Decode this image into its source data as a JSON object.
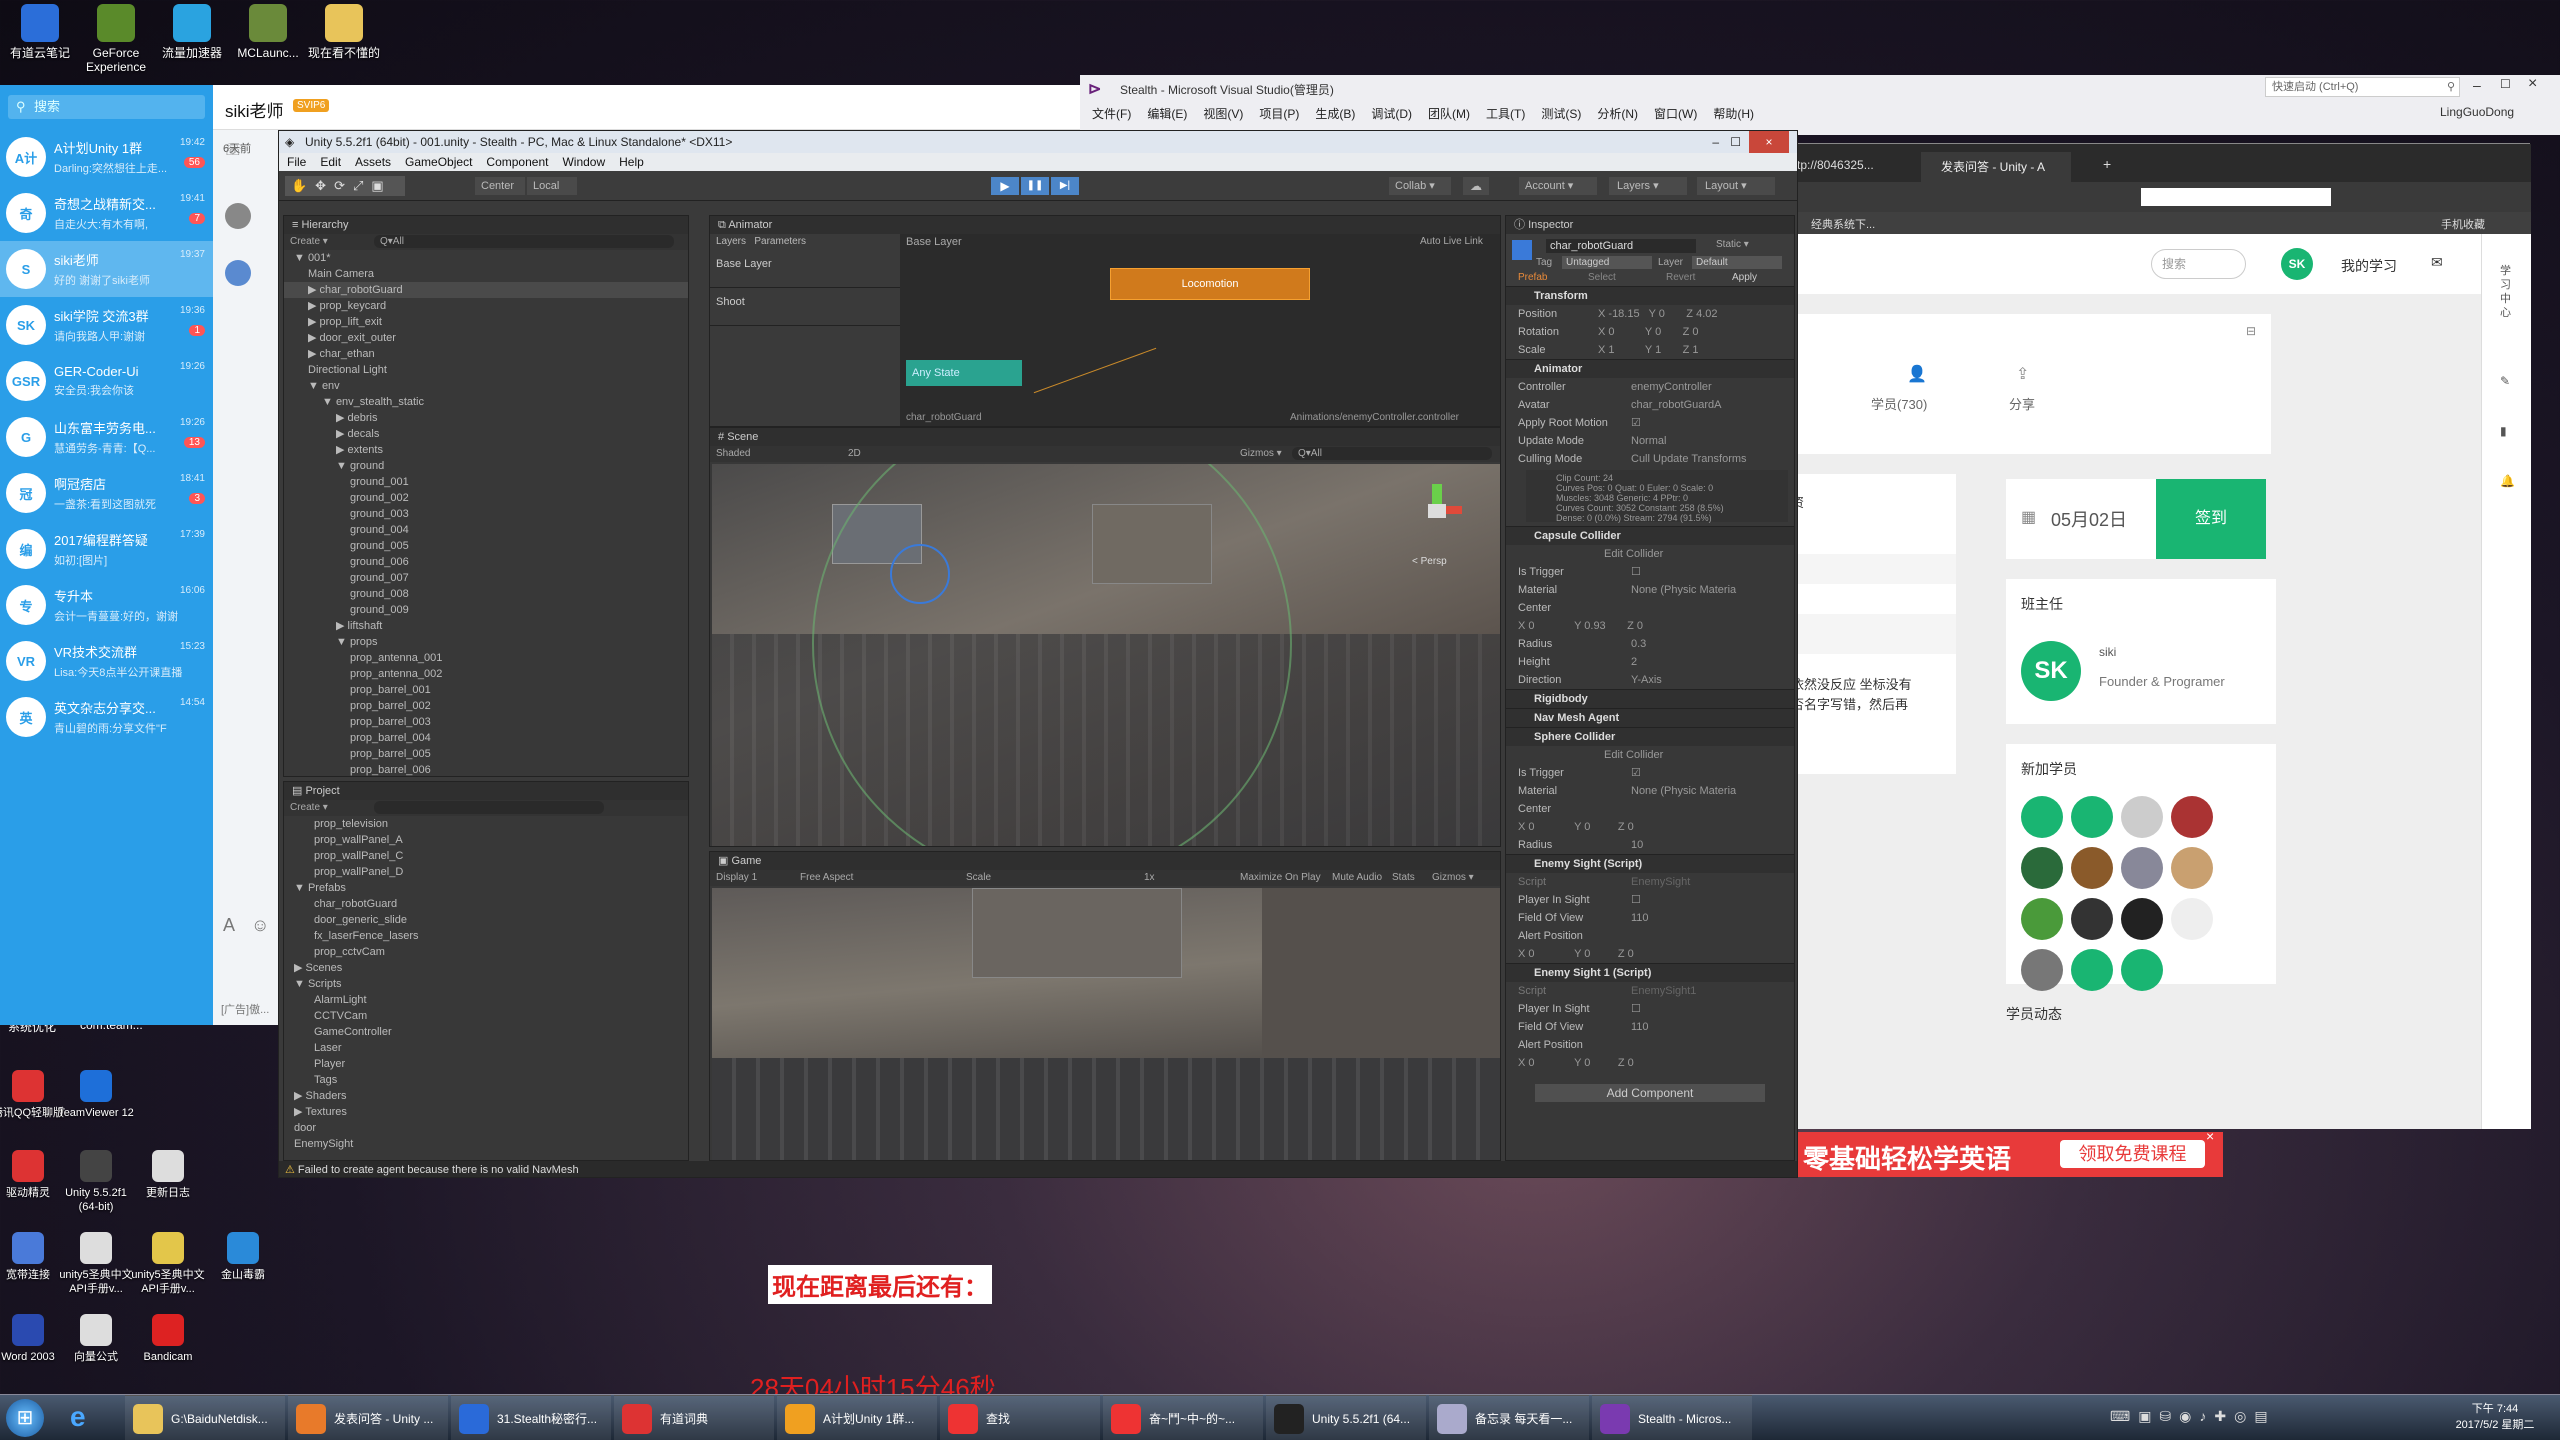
{
  "desktop": {
    "icons": [
      {
        "label": "有道云笔记",
        "color": "#2b6ed9"
      },
      {
        "label": "GeForce Experience",
        "color": "#5a8a2a"
      },
      {
        "label": "流量加速器",
        "color": "#2aa3e0"
      },
      {
        "label": "MCLaunc...",
        "color": "#6a8a3a"
      },
      {
        "label": "现在看不懂的",
        "color": "#e8c45a"
      }
    ],
    "left_icons": [
      {
        "label": "腾讯QQ轻聊版",
        "color": "#d33"
      },
      {
        "label": "TeamViewer 12",
        "color": "#1e6fd9"
      },
      {
        "label": "驱动精灵",
        "color": "#d33"
      },
      {
        "label": "Unity 5.5.2f1 (64-bit)",
        "color": "#444"
      },
      {
        "label": "更新日志",
        "color": "#ddd"
      },
      {
        "label": "宽带连接",
        "color": "#4a7ad9"
      },
      {
        "label": "unity5圣典中文API手册v...",
        "color": "#ddd"
      },
      {
        "label": "unity5圣典中文API手册v...",
        "color": "#e3c64a"
      },
      {
        "label": "金山毒霸",
        "color": "#2a8ad9"
      },
      {
        "label": "Word 2003",
        "color": "#2a4ab0"
      },
      {
        "label": "向量公式",
        "color": "#ddd"
      },
      {
        "label": "Bandicam",
        "color": "#d22"
      }
    ],
    "strip": [
      "系统优化",
      "com.team..."
    ],
    "countdown_label": "现在距离最后还有：",
    "countdown_value": "28天04小时15分46秒",
    "ad_text": "零基础轻松学英语",
    "ad_button": "领取免费课程"
  },
  "qq": {
    "user": "siki老师",
    "vip": "SVIP6",
    "search": "搜索",
    "side_text": "6天前",
    "ad": "[广告]傲...",
    "chats": [
      {
        "name": "A计划Unity 1群",
        "preview": "Darling:突然想往上走...",
        "time": "19:42",
        "badge": "56",
        "av": "A计"
      },
      {
        "name": "奇想之战精新交...",
        "preview": "自走火大:有木有啊,",
        "time": "19:41",
        "badge": "7",
        "av": "奇"
      },
      {
        "name": "siki老师",
        "preview": "好的 谢谢了siki老师",
        "time": "19:37",
        "badge": "",
        "av": "S"
      },
      {
        "name": "siki学院 交流3群",
        "preview": "请向我路人甲:谢谢",
        "time": "19:36",
        "badge": "1",
        "av": "SK"
      },
      {
        "name": "GER-Coder-Ui",
        "preview": "安全员:我会你该",
        "time": "19:26",
        "badge": "",
        "av": "GSR"
      },
      {
        "name": "山东富丰劳务电...",
        "preview": "慧通劳务-青青:【Q...",
        "time": "19:26",
        "badge": "13",
        "av": "G"
      },
      {
        "name": "啊冠痞店",
        "preview": "一盏茶:看到这图就死",
        "time": "18:41",
        "badge": "3",
        "av": "冠"
      },
      {
        "name": "2017编程群答疑",
        "preview": "如初:[图片]",
        "time": "17:39",
        "badge": "",
        "av": "编"
      },
      {
        "name": "专升本",
        "preview": "会计一青蔓蔓:好的，谢谢",
        "time": "16:06",
        "badge": "",
        "av": "专"
      },
      {
        "name": "VR技术交流群",
        "preview": "Lisa:今天8点半公开课直播",
        "time": "15:23",
        "badge": "",
        "av": "VR"
      },
      {
        "name": "英文杂志分享交...",
        "preview": "青山碧的雨:分享文件\"F",
        "time": "14:54",
        "badge": "",
        "av": "英"
      }
    ]
  },
  "vs": {
    "title": "Stealth - Microsoft Visual Studio(管理员)",
    "quick": "快速启动 (Ctrl+Q)",
    "user": "LingGuoDong",
    "menu": [
      "文件(F)",
      "编辑(E)",
      "视图(V)",
      "项目(P)",
      "生成(B)",
      "调试(D)",
      "团队(M)",
      "工具(T)",
      "测试(S)",
      "分析(N)",
      "窗口(W)",
      "帮助(H)"
    ]
  },
  "browser": {
    "tab1": "tp://8046325...",
    "tab2": "发表问答 - Unity - A",
    "bookmark": "经典系统下...",
    "phone": "手机收藏",
    "search": "搜索",
    "my_study": "我的学习",
    "students": "学员(730)",
    "share": "分享",
    "date": "05月02日",
    "checkin": "签到",
    "owner_title": "班主任",
    "owner_name": "siki",
    "owner_role": "Founder & Programer",
    "new_students": "新加学员",
    "dynamics": "学员动态",
    "side_chars": "学习中心",
    "snippet1": "资",
    "snippet2": "依然没反应 坐标没有",
    "snippet3": "否名字写错，然后再"
  },
  "unity": {
    "title": "Unity 5.5.2f1 (64bit) - 001.unity - Stealth - PC, Mac & Linux Standalone* <DX11>",
    "menu": [
      "File",
      "Edit",
      "Assets",
      "GameObject",
      "Component",
      "Window",
      "Help"
    ],
    "toolbar": {
      "center": "Center",
      "local": "Local",
      "collab": "Collab ▾",
      "account": "Account ▾",
      "layers": "Layers ▾",
      "layout": "Layout ▾"
    },
    "hierarchy": {
      "title": "Hierarchy",
      "create": "Create ▾",
      "search": "Q▾All",
      "items": [
        {
          "t": "▼ 001*",
          "d": 0
        },
        {
          "t": "Main Camera",
          "d": 1
        },
        {
          "t": "▶ char_robotGuard",
          "d": 1
        },
        {
          "t": "▶ prop_keycard",
          "d": 1
        },
        {
          "t": "▶ prop_lift_exit",
          "d": 1
        },
        {
          "t": "▶ door_exit_outer",
          "d": 1
        },
        {
          "t": "▶ char_ethan",
          "d": 1
        },
        {
          "t": "Directional Light",
          "d": 1
        },
        {
          "t": "▼ env",
          "d": 1
        },
        {
          "t": "▼ env_stealth_static",
          "d": 2
        },
        {
          "t": "▶ debris",
          "d": 3
        },
        {
          "t": "▶ decals",
          "d": 3
        },
        {
          "t": "▶ extents",
          "d": 3
        },
        {
          "t": "▼ ground",
          "d": 3
        },
        {
          "t": "ground_001",
          "d": 4
        },
        {
          "t": "ground_002",
          "d": 4
        },
        {
          "t": "ground_003",
          "d": 4
        },
        {
          "t": "ground_004",
          "d": 4
        },
        {
          "t": "ground_005",
          "d": 4
        },
        {
          "t": "ground_006",
          "d": 4
        },
        {
          "t": "ground_007",
          "d": 4
        },
        {
          "t": "ground_008",
          "d": 4
        },
        {
          "t": "ground_009",
          "d": 4
        },
        {
          "t": "▶ liftshaft",
          "d": 3
        },
        {
          "t": "▼ props",
          "d": 3
        },
        {
          "t": "prop_antenna_001",
          "d": 4
        },
        {
          "t": "prop_antenna_002",
          "d": 4
        },
        {
          "t": "prop_barrel_001",
          "d": 4
        },
        {
          "t": "prop_barrel_002",
          "d": 4
        },
        {
          "t": "prop_barrel_003",
          "d": 4
        },
        {
          "t": "prop_barrel_004",
          "d": 4
        },
        {
          "t": "prop_barrel_005",
          "d": 4
        },
        {
          "t": "prop_barrel_006",
          "d": 4
        }
      ]
    },
    "project": {
      "title": "Project",
      "create": "Create ▾",
      "items": [
        {
          "t": "prop_television",
          "d": 1
        },
        {
          "t": "prop_wallPanel_A",
          "d": 1
        },
        {
          "t": "prop_wallPanel_C",
          "d": 1
        },
        {
          "t": "prop_wallPanel_D",
          "d": 1
        },
        {
          "t": "▼ Prefabs",
          "d": 0
        },
        {
          "t": "char_robotGuard",
          "d": 1
        },
        {
          "t": "door_generic_slide",
          "d": 1
        },
        {
          "t": "fx_laserFence_lasers",
          "d": 1
        },
        {
          "t": "prop_cctvCam",
          "d": 1
        },
        {
          "t": "▶ Scenes",
          "d": 0
        },
        {
          "t": "▼ Scripts",
          "d": 0
        },
        {
          "t": "AlarmLight",
          "d": 1
        },
        {
          "t": "CCTVCam",
          "d": 1
        },
        {
          "t": "GameController",
          "d": 1
        },
        {
          "t": "Laser",
          "d": 1
        },
        {
          "t": "Player",
          "d": 1
        },
        {
          "t": "Tags",
          "d": 1
        },
        {
          "t": "▶ Shaders",
          "d": 0
        },
        {
          "t": "▶ Textures",
          "d": 0
        },
        {
          "t": "door",
          "d": 0
        },
        {
          "t": "EnemySight",
          "d": 0
        }
      ]
    },
    "animator": {
      "title": "Animator",
      "tabs": [
        "Layers",
        "Parameters"
      ],
      "base_layer": "Base Layer",
      "layers": [
        "Base Layer",
        "Shoot"
      ],
      "auto_live": "Auto Live Link",
      "state": "Locomotion",
      "any_state": "Any State",
      "footer_left": "char_robotGuard",
      "footer_right": "Animations/enemyController.controller"
    },
    "scene": {
      "title": "Scene",
      "shaded": "Shaded",
      "mode2d": "2D",
      "gizmos": "Gizmos ▾",
      "search": "Q▾All",
      "persp": "< Persp"
    },
    "game": {
      "title": "Game",
      "display": "Display 1",
      "aspect": "Free Aspect",
      "scale": "Scale",
      "scale_val": "1x",
      "maximize": "Maximize On Play",
      "mute": "Mute Audio",
      "stats": "Stats",
      "gizmos": "Gizmos ▾"
    },
    "inspector": {
      "title": "Inspector",
      "object": "char_robotGuard",
      "static": "Static ▾",
      "tag_label": "Tag",
      "tag": "Untagged",
      "layer_label": "Layer",
      "layer": "Default",
      "prefab": "Prefab",
      "select": "Select",
      "revert": "Revert",
      "apply": "Apply",
      "transform": "Transform",
      "position": "Position",
      "px": "-18.15",
      "py": "0",
      "pz": "4.02",
      "rotation": "Rotation",
      "rx": "0",
      "ry": "0",
      "rz": "0",
      "scale": "Scale",
      "sx": "1",
      "sy": "1",
      "sz": "1",
      "animator": "Animator",
      "controller_l": "Controller",
      "controller": "enemyController",
      "avatar_l": "Avatar",
      "avatar": "char_robotGuardA",
      "root_motion": "Apply Root Motion",
      "update_l": "Update Mode",
      "update": "Normal",
      "culling_l": "Culling Mode",
      "culling": "Cull Update Transforms",
      "anim_info": "Clip Count: 24\nCurves Pos: 0 Quat: 0 Euler: 0 Scale: 0\nMuscles: 3048 Generic: 4 PPtr: 0\nCurves Count: 3052 Constant: 258 (8.5%)\nDense: 0 (0.0%) Stream: 2794 (91.5%)",
      "capsule": "Capsule Collider",
      "edit_collider": "Edit Collider",
      "is_trigger": "Is Trigger",
      "material": "Material",
      "material_v": "None (Physic Materia",
      "center": "Center",
      "cx": "0",
      "cy": "0.93",
      "cz": "0",
      "radius": "Radius",
      "radius_v": "0.3",
      "height": "Height",
      "height_v": "2",
      "direction": "Direction",
      "direction_v": "Y-Axis",
      "rigidbody": "Rigidbody",
      "navmesh": "Nav Mesh Agent",
      "sphere": "Sphere Collider",
      "s_radius_v": "10",
      "enemy_sight": "Enemy Sight (Script)",
      "script": "Script",
      "script_v": "EnemySight",
      "player_in_sight": "Player In Sight",
      "fov": "Field Of View",
      "fov_v": "110",
      "alert": "Alert Position",
      "ax": "0",
      "ay": "0",
      "az": "0",
      "enemy_sight1": "Enemy Sight 1 (Script)",
      "script1_v": "EnemySight1",
      "add_component": "Add Component"
    },
    "status": "Failed to create agent because there is no valid NavMesh"
  },
  "taskbar": {
    "items": [
      "G:\\BaiduNetdisk...",
      "发表问答 - Unity ...",
      "31.Stealth秘密行...",
      "有道词典",
      "A计划Unity 1群...",
      "查找",
      "奋~鬥~中~的~...",
      "Unity 5.5.2f1 (64...",
      "备忘录 每天看一...",
      "Stealth - Micros..."
    ],
    "colors": [
      "#e8c45a",
      "#e87a2a",
      "#2a6ad9",
      "#d33",
      "#f0a020",
      "#e33",
      "#e33",
      "#222",
      "#aac",
      "#7a3ab0"
    ],
    "time": "下午 7:44",
    "date": "2017/5/2 星期二"
  }
}
